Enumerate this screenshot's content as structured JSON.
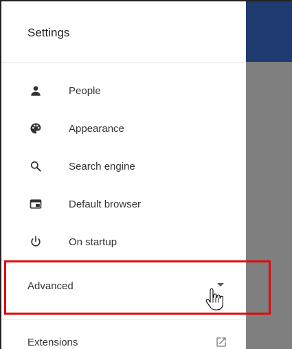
{
  "drawer": {
    "title": "Settings",
    "items": [
      {
        "label": "People",
        "icon": "person-icon"
      },
      {
        "label": "Appearance",
        "icon": "palette-icon"
      },
      {
        "label": "Search engine",
        "icon": "search-icon"
      },
      {
        "label": "Default browser",
        "icon": "browser-window-icon"
      },
      {
        "label": "On startup",
        "icon": "power-icon"
      }
    ],
    "advanced": {
      "label": "Advanced",
      "icon": "caret-down-icon"
    },
    "extensions": {
      "label": "Extensions",
      "icon": "open-in-new-icon"
    }
  },
  "colors": {
    "header_blue": "#1f3a6e",
    "scrim_gray": "#7f7f7f",
    "highlight_red": "#e10a0a"
  }
}
